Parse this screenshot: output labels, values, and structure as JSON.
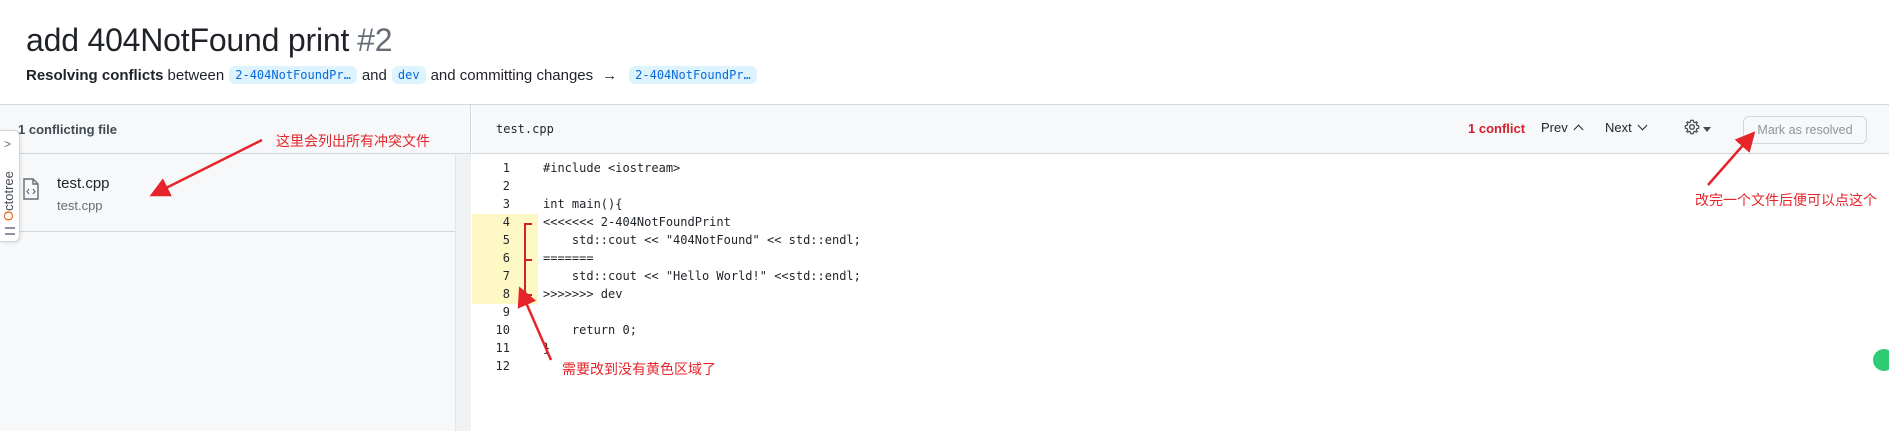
{
  "pr": {
    "title": "add 404NotFound print",
    "number": "#2",
    "subtitle_bold": "Resolving conflicts",
    "between_word": "between",
    "head_branch": "2-404NotFoundPr…",
    "and_word": "and",
    "base_branch": "dev",
    "committing_text": "and committing changes",
    "arrow": "→",
    "target_branch": "2-404NotFoundPr…"
  },
  "sidebar": {
    "heading": "1 conflicting file",
    "files": [
      {
        "name": "test.cpp",
        "path": "test.cpp"
      }
    ]
  },
  "octotree": {
    "label_o": "O",
    "label_rest": "ctotree",
    "chevron": ">"
  },
  "editor": {
    "filename": "test.cpp",
    "conflict_count": "1 conflict",
    "prev_label": "Prev",
    "next_label": "Next",
    "gear_icon": "gear-icon",
    "mark_resolved_label": "Mark as resolved",
    "conflict_color": "#fdf8c4",
    "lines": [
      {
        "n": "1",
        "text": "#include <iostream>"
      },
      {
        "n": "2",
        "text": ""
      },
      {
        "n": "3",
        "text": "int main(){"
      },
      {
        "n": "4",
        "text": "<<<<<<< 2-404NotFoundPrint"
      },
      {
        "n": "5",
        "text": "    std::cout << \"404NotFound\" << std::endl;"
      },
      {
        "n": "6",
        "text": "======="
      },
      {
        "n": "7",
        "text": "    std::cout << \"Hello World!\" <<std::endl;"
      },
      {
        "n": "8",
        "text": ">>>>>>> dev"
      },
      {
        "n": "9",
        "text": ""
      },
      {
        "n": "10",
        "text": "    return 0;"
      },
      {
        "n": "11",
        "text": "}"
      },
      {
        "n": "12",
        "text": ""
      }
    ]
  },
  "annotations": {
    "files_note": "这里会列出所有冲突文件",
    "yellow_note": "需要改到没有黄色区域了",
    "resolve_note": "改完一个文件后便可以点这个",
    "color": "#e5252a"
  }
}
